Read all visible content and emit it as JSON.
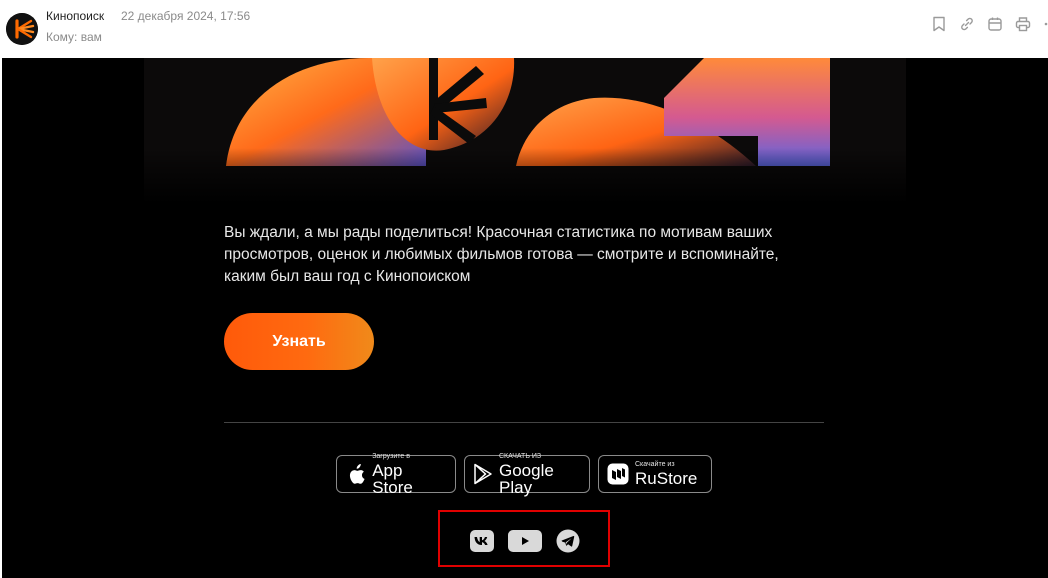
{
  "header": {
    "sender": "Кинопоиск",
    "date": "22 декабря 2024, 17:56",
    "to": "Кому: вам",
    "actions": [
      "bookmark-icon",
      "link-icon",
      "calendar-icon",
      "print-icon",
      "more-icon"
    ]
  },
  "body": {
    "promo_text": "Вы ждали, а мы рады поделиться! Красочная статистика по мотивам ваших просмотров, оценок и любимых фильмов готова — смотрите и вспоминайте, каким был ваш год с Кинопоиском",
    "cta_label": "Узнать"
  },
  "stores": [
    {
      "small": "Загрузите в",
      "big": "App Store",
      "icon": "apple-icon"
    },
    {
      "small": "СКАЧАТЬ ИЗ",
      "big": "Google Play",
      "icon": "google-play-icon"
    },
    {
      "small": "Скачайте из",
      "big": "RuStore",
      "icon": "rustore-icon"
    }
  ],
  "socials": [
    "vk-icon",
    "youtube-icon",
    "telegram-icon"
  ],
  "colors": {
    "accent": "#ff5a0a",
    "background": "#000000",
    "highlight": "#e00000"
  }
}
